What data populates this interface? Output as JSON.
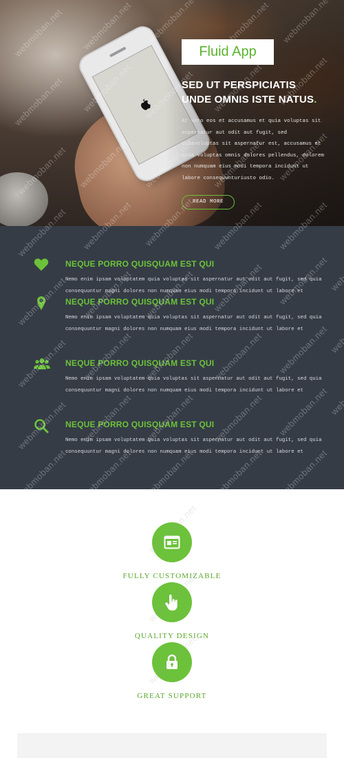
{
  "hero": {
    "brand": "Fluid App",
    "heading_line1": "SED UT PERSPICIATIS",
    "heading_line2": "UNDE OMNIS ISTE NATUS",
    "heading_dot": ".",
    "text": "At vero eos et accusamus et quia voluptas sit aspernatur aut odit aut fugit, sed quiavoluptas sit aspernatur est, accusamus et quia voluptas omnis dolores pellendus, dolorem non numquam eius modi tempora incidunt ut labore consequunturiusto odio.",
    "read_more": "READ MORE"
  },
  "features": [
    {
      "icon": "heart-icon",
      "title": "NEQUE PORRO QUISQUAM EST QUI",
      "line1": "Nemo enim ipsam voluptatem quia voluptas sit aspernatur aut odit aut fugit, sed quia",
      "line2": "consequuntur magni dolores non numquam eius modi tempora incidunt ut labore et"
    },
    {
      "icon": "map-pin-icon",
      "title": "NEQUE PORRO QUISQUAM EST QUI",
      "line1": "Nemo enim ipsam voluptatem quia voluptas sit aspernatur aut odit aut fugit, sed quia",
      "line2": "consequuntur magni dolores non numquam eius modi tempora incidunt ut labore et"
    },
    {
      "icon": "users-icon",
      "title": "NEQUE PORRO QUISQUAM EST QUI",
      "line1": "Nemo enim ipsam voluptatem quia voluptas sit aspernatur aut odit aut fugit, sed quia",
      "line2": "consequuntur magni dolores non numquam eius modi tempora incidunt ut labore et"
    },
    {
      "icon": "search-icon",
      "title": "NEQUE PORRO QUISQUAM EST QUI",
      "line1": "Nemo enim ipsam voluptatem quia voluptas sit aspernatur aut odit aut fugit, sed quia",
      "line2": "consequuntur magni dolores non numquam eius modi tempora incidunt ut labore et"
    }
  ],
  "services": [
    {
      "icon": "browser-card-icon",
      "label": "FULLY CUSTOMIZABLE"
    },
    {
      "icon": "pointer-hand-icon",
      "label": "QUALITY DESIGN"
    },
    {
      "icon": "lock-icon",
      "label": "GREAT SUPPORT"
    }
  ],
  "watermark": "webmoban.net",
  "colors": {
    "accent": "#6cc23a",
    "dark_band": "#353c46",
    "white": "#ffffff"
  }
}
